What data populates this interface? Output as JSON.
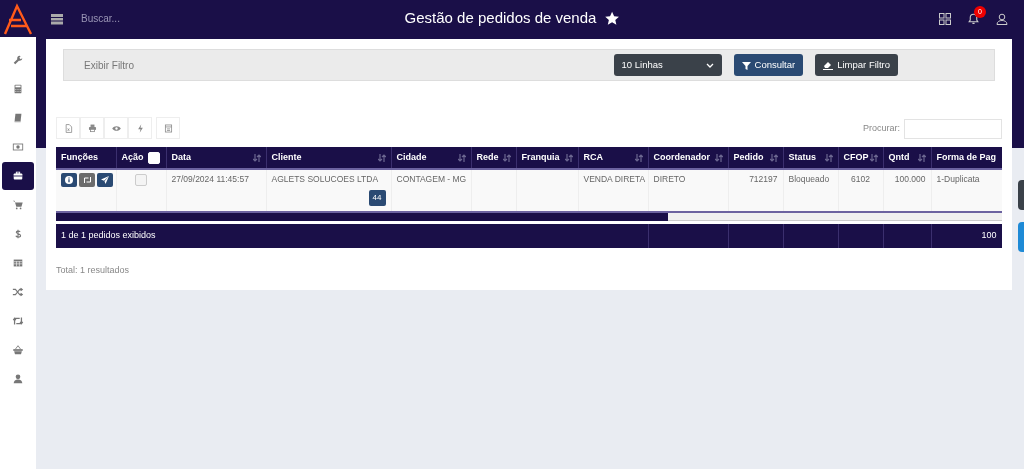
{
  "header": {
    "search": {
      "placeholder": "Buscar..."
    },
    "title": "Gestão de pedidos de venda",
    "notifications": "0"
  },
  "sidebar": {
    "items": [
      {
        "selected": false
      },
      {
        "selected": false
      },
      {
        "selected": false
      },
      {
        "selected": false
      },
      {
        "selected": true
      },
      {
        "selected": false
      },
      {
        "selected": false
      },
      {
        "selected": false
      },
      {
        "selected": false
      },
      {
        "selected": false
      },
      {
        "selected": false
      },
      {
        "selected": false
      }
    ]
  },
  "filter": {
    "toggle": "Exibir Filtro",
    "rows_select": "10 Linhas",
    "buttons": [
      {
        "label": "Consultar",
        "kind": "primary"
      },
      {
        "label": "Limpar Filtro",
        "kind": "secondary"
      }
    ]
  },
  "toolbar": {
    "search_label": "Procurar:"
  },
  "table": {
    "columns": [
      {
        "label": "Funções"
      },
      {
        "label": "Ação",
        "checked": false
      },
      {
        "label": "Data",
        "sortable": true
      },
      {
        "label": "Cliente",
        "sortable": true
      },
      {
        "label": "Cidade",
        "sortable": true
      },
      {
        "label": "Rede",
        "sortable": true
      },
      {
        "label": "Franquia",
        "sortable": true
      },
      {
        "label": "RCA",
        "sortable": true
      },
      {
        "label": "Coordenador",
        "sortable": true
      },
      {
        "label": "Pedido",
        "sortable": true
      },
      {
        "label": "Status",
        "sortable": true
      },
      {
        "label": "CFOP",
        "sortable": true
      },
      {
        "label": "Qntd",
        "sortable": true
      },
      {
        "label": "Forma de Pag"
      }
    ],
    "rows": [
      {
        "checked": false,
        "data": "27/09/2024 11:45:57",
        "cliente": "AGLETS SOLUCOES LTDA",
        "cliente_badge": "44",
        "cidade": "CONTAGEM - MG",
        "rca": "VENDA DIRETA",
        "coordenador": "DIRETO",
        "pedido": "712197",
        "status": "Bloqueado",
        "cfop": "6102",
        "qntd": "100.000",
        "forma_pag": "1-Duplicata"
      }
    ],
    "footer": {
      "summary": "1 de 1 pedidos exibidos",
      "total_qntd": "100"
    }
  },
  "total": "Total: 1 resultados"
}
